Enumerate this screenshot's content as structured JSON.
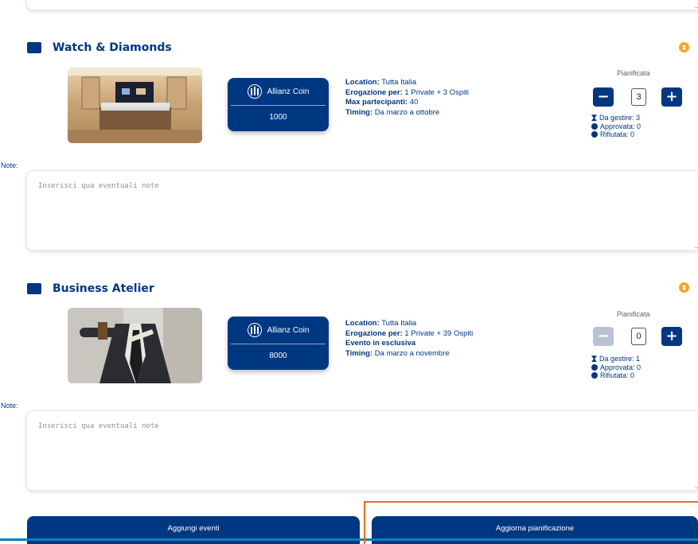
{
  "top_note": {
    "placeholder": ""
  },
  "events": [
    {
      "title": "Watch & Diamonds",
      "coin_brand": "Allianz Coin",
      "coin_value": "1000",
      "details": [
        {
          "label": "Location:",
          "value": " Tutta Italia"
        },
        {
          "label": "Erogazione per:",
          "value": " 1 Private + 3 Ospiti"
        },
        {
          "label": "Max partecipanti:",
          "value": " 40"
        },
        {
          "label": "Timing:",
          "value": " Da marzo a ottobre"
        }
      ],
      "plan_label": "Pianificata",
      "quantity": "3",
      "status": {
        "da_gestire": "Da gestire: 3",
        "approvata": "Approvata: 0",
        "rifiutata": "Rifiutata: 0"
      },
      "note_label": "Note:",
      "note_placeholder": "Inserisci qua eventuali note"
    },
    {
      "title": "Business Atelier",
      "coin_brand": "Allianz Coin",
      "coin_value": "8000",
      "details": [
        {
          "label": "Location:",
          "value": " Tutta Italia"
        },
        {
          "label": "Erogazione per:",
          "value": " 1 Private + 39 Ospiti"
        },
        {
          "label": "Evento in esclusiva",
          "value": ""
        },
        {
          "label": "Timing:",
          "value": " Da marzo a novembre"
        }
      ],
      "plan_label": "Pianificata",
      "quantity": "0",
      "status": {
        "da_gestire": "Da gestire: 1",
        "approvata": "Approvata: 0",
        "rifiutata": "Rifiutata: 0"
      },
      "note_label": "Note:",
      "note_placeholder": "Inserisci qua eventuali note"
    }
  ],
  "footer": {
    "add_events_label": "Aggiungi eventi",
    "update_plan_label": "Aggiorna pianificazione"
  },
  "colors": {
    "brand": "#003781",
    "warning": "#f5a623",
    "highlight": "#f06a1d",
    "accent_line": "#0a7fc0"
  },
  "icons": {
    "minus": "minus-icon",
    "plus": "plus-icon",
    "hourglass": "hourglass-icon",
    "check": "check-circle-icon",
    "reject": "x-circle-icon",
    "coin": "allianz-logo-icon"
  }
}
